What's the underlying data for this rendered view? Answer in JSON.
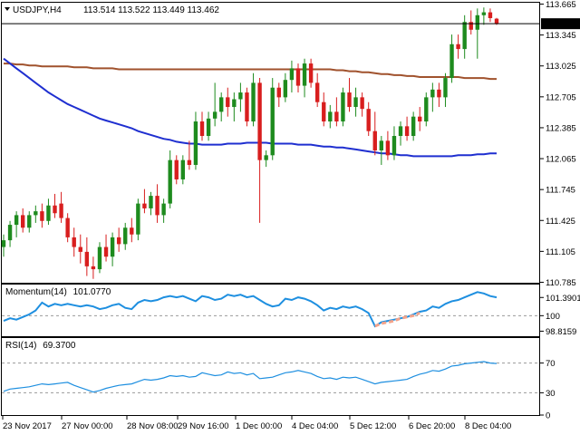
{
  "chart_data": {
    "type": "candlestick",
    "symbol_label": "USDJPY,H4",
    "ohlc_label": "113.514 113.522 113.449 113.462",
    "last_price_label": "113.462",
    "price_ylim": [
      110.78,
      113.67
    ],
    "price_ticks": [
      "113.665",
      "113.345",
      "113.025",
      "112.705",
      "112.385",
      "112.065",
      "111.745",
      "111.425",
      "111.105",
      "110.785"
    ],
    "x_labels": [
      "23 Nov 2017",
      "27 Nov 00:00",
      "28 Nov 08:00",
      "29 Nov 16:00",
      "1 Dec 00:00",
      "4 Dec 04:00",
      "5 Dec 12:00",
      "6 Dec 20:00",
      "8 Dec 04:00"
    ],
    "candles": [
      [
        111.15,
        111.28,
        111.05,
        111.22
      ],
      [
        111.22,
        111.42,
        111.15,
        111.38
      ],
      [
        111.38,
        111.52,
        111.25,
        111.48
      ],
      [
        111.48,
        111.55,
        111.3,
        111.35
      ],
      [
        111.35,
        111.52,
        111.3,
        111.48
      ],
      [
        111.48,
        111.58,
        111.4,
        111.52
      ],
      [
        111.52,
        111.6,
        111.35,
        111.42
      ],
      [
        111.42,
        111.65,
        111.38,
        111.58
      ],
      [
        111.58,
        111.7,
        111.45,
        111.5
      ],
      [
        111.6,
        111.72,
        111.4,
        111.45
      ],
      [
        111.45,
        111.5,
        111.2,
        111.25
      ],
      [
        111.25,
        111.35,
        111.05,
        111.15
      ],
      [
        111.15,
        111.28,
        110.98,
        111.1
      ],
      [
        111.1,
        111.25,
        110.85,
        110.95
      ],
      [
        110.95,
        111.05,
        110.82,
        110.92
      ],
      [
        110.92,
        111.2,
        110.88,
        111.15
      ],
      [
        111.15,
        111.28,
        111.0,
        111.05
      ],
      [
        111.05,
        111.3,
        110.95,
        111.25
      ],
      [
        111.25,
        111.35,
        111.1,
        111.18
      ],
      [
        111.18,
        111.4,
        111.12,
        111.35
      ],
      [
        111.35,
        111.45,
        111.2,
        111.28
      ],
      [
        111.28,
        111.65,
        111.22,
        111.6
      ],
      [
        111.6,
        111.75,
        111.5,
        111.55
      ],
      [
        111.55,
        111.72,
        111.48,
        111.68
      ],
      [
        111.68,
        111.8,
        111.4,
        111.48
      ],
      [
        111.48,
        111.65,
        111.4,
        111.6
      ],
      [
        111.6,
        112.15,
        111.55,
        112.05
      ],
      [
        112.05,
        112.1,
        111.8,
        111.85
      ],
      [
        111.85,
        112.1,
        111.8,
        112.05
      ],
      [
        112.05,
        112.25,
        111.95,
        112.0
      ],
      [
        112.0,
        112.55,
        111.95,
        112.45
      ],
      [
        112.45,
        112.55,
        112.25,
        112.3
      ],
      [
        112.3,
        112.55,
        112.25,
        112.48
      ],
      [
        112.48,
        112.85,
        112.4,
        112.55
      ],
      [
        112.55,
        112.75,
        112.45,
        112.7
      ],
      [
        112.7,
        112.8,
        112.5,
        112.6
      ],
      [
        112.6,
        112.75,
        112.45,
        112.68
      ],
      [
        112.68,
        112.85,
        112.55,
        112.75
      ],
      [
        112.75,
        112.8,
        112.4,
        112.45
      ],
      [
        112.45,
        112.95,
        112.4,
        112.85
      ],
      [
        112.85,
        112.9,
        111.4,
        112.05
      ],
      [
        112.05,
        112.15,
        111.98,
        112.1
      ],
      [
        112.1,
        112.9,
        112.05,
        112.8
      ],
      [
        112.8,
        112.85,
        112.6,
        112.7
      ],
      [
        112.7,
        112.95,
        112.65,
        112.88
      ],
      [
        112.88,
        113.08,
        112.75,
        113.0
      ],
      [
        113.0,
        113.05,
        112.75,
        112.82
      ],
      [
        112.82,
        113.1,
        112.7,
        113.05
      ],
      [
        113.05,
        113.1,
        112.8,
        112.85
      ],
      [
        112.85,
        112.95,
        112.6,
        112.65
      ],
      [
        112.65,
        112.75,
        112.4,
        112.45
      ],
      [
        112.45,
        112.62,
        112.38,
        112.55
      ],
      [
        112.55,
        112.7,
        112.4,
        112.45
      ],
      [
        112.45,
        112.8,
        112.4,
        112.75
      ],
      [
        112.75,
        112.9,
        112.55,
        112.6
      ],
      [
        112.6,
        112.8,
        112.5,
        112.7
      ],
      [
        112.7,
        112.75,
        112.5,
        112.58
      ],
      [
        112.58,
        112.65,
        112.3,
        112.35
      ],
      [
        112.35,
        112.55,
        112.1,
        112.15
      ],
      [
        112.15,
        112.3,
        112.0,
        112.25
      ],
      [
        112.25,
        112.35,
        112.05,
        112.1
      ],
      [
        112.1,
        112.4,
        112.05,
        112.3
      ],
      [
        112.3,
        112.45,
        112.2,
        112.4
      ],
      [
        112.4,
        112.5,
        112.25,
        112.3
      ],
      [
        112.3,
        112.55,
        112.25,
        112.5
      ],
      [
        112.5,
        112.6,
        112.35,
        112.45
      ],
      [
        112.45,
        112.75,
        112.4,
        112.7
      ],
      [
        112.7,
        112.85,
        112.55,
        112.78
      ],
      [
        112.78,
        112.85,
        112.6,
        112.7
      ],
      [
        112.7,
        112.95,
        112.6,
        112.9
      ],
      [
        112.9,
        113.35,
        112.85,
        113.25
      ],
      [
        113.25,
        113.35,
        113.1,
        113.2
      ],
      [
        113.2,
        113.55,
        113.1,
        113.48
      ],
      [
        113.48,
        113.6,
        113.35,
        113.4
      ],
      [
        113.4,
        113.62,
        113.1,
        113.55
      ],
      [
        113.55,
        113.63,
        113.45,
        113.58
      ],
      [
        113.58,
        113.62,
        113.48,
        113.52
      ],
      [
        113.514,
        113.522,
        113.449,
        113.462
      ]
    ],
    "series": [
      {
        "name": "Momentum(14)",
        "value_label": "101.0770",
        "color": "#1e8fe0",
        "ylim": [
          98.5,
          102.1
        ],
        "ticks": [
          "101.3901",
          "100",
          "98.8159"
        ],
        "values": [
          99.6,
          99.8,
          99.7,
          99.9,
          100.1,
          100.4,
          101.0,
          100.7,
          100.9,
          100.8,
          100.9,
          100.8,
          100.7,
          100.8,
          100.7,
          100.5,
          100.6,
          100.8,
          100.9,
          100.6,
          100.5,
          101.0,
          101.2,
          101.1,
          101.2,
          101.4,
          101.5,
          101.4,
          101.5,
          101.3,
          101.1,
          101.5,
          101.4,
          101.2,
          101.3,
          101.6,
          101.5,
          101.6,
          101.4,
          101.5,
          101.2,
          100.9,
          100.7,
          100.8,
          101.3,
          101.2,
          101.4,
          101.3,
          101.1,
          100.8,
          100.4,
          100.6,
          100.5,
          100.7,
          100.6,
          100.7,
          100.5,
          100.2,
          99.2,
          99.5,
          99.6,
          99.7,
          99.8,
          99.9,
          100.1,
          100.3,
          100.4,
          100.7,
          100.6,
          100.9,
          101.1,
          101.2,
          101.4,
          101.6,
          101.8,
          101.7,
          101.5,
          101.4
        ]
      },
      {
        "name": "RSI(14)",
        "value_label": "69.3700",
        "color": "#1e8fe0",
        "ylim": [
          0,
          100
        ],
        "ticks": [
          "70",
          "30",
          "0"
        ],
        "values": [
          32,
          35,
          36,
          37,
          38,
          40,
          42,
          41,
          42,
          43,
          44,
          40,
          37,
          34,
          31,
          33,
          36,
          38,
          40,
          41,
          42,
          45,
          48,
          47,
          48,
          50,
          53,
          52,
          53,
          51,
          52,
          57,
          55,
          53,
          54,
          58,
          56,
          57,
          54,
          56,
          49,
          50,
          51,
          54,
          57,
          58,
          60,
          58,
          56,
          52,
          49,
          50,
          48,
          51,
          50,
          51,
          48,
          45,
          42,
          44,
          45,
          46,
          47,
          48,
          52,
          55,
          57,
          60,
          59,
          62,
          66,
          67,
          69,
          70,
          71,
          72,
          70,
          69.37
        ]
      }
    ],
    "overlays": [
      {
        "name": "slow-ma",
        "color": "#a0522d",
        "values": [
          113.05,
          113.05,
          113.04,
          113.04,
          113.03,
          113.03,
          113.02,
          113.02,
          113.02,
          113.02,
          113.02,
          113.01,
          113.01,
          113.01,
          113.0,
          113.0,
          113.0,
          113.0,
          112.99,
          112.99,
          112.99,
          112.99,
          112.99,
          112.99,
          112.99,
          112.99,
          112.99,
          112.99,
          112.99,
          112.99,
          112.99,
          112.99,
          112.99,
          112.99,
          112.99,
          112.99,
          112.99,
          112.99,
          112.99,
          112.99,
          112.99,
          112.99,
          112.99,
          112.99,
          112.99,
          112.99,
          112.99,
          112.99,
          112.99,
          112.99,
          112.99,
          112.99,
          112.98,
          112.98,
          112.97,
          112.97,
          112.96,
          112.96,
          112.95,
          112.94,
          112.94,
          112.93,
          112.93,
          112.92,
          112.92,
          112.91,
          112.91,
          112.91,
          112.91,
          112.91,
          112.91,
          112.91,
          112.9,
          112.9,
          112.9,
          112.9,
          112.89,
          112.89
        ]
      },
      {
        "name": "fast-ma",
        "color": "#1f2fd0",
        "values": [
          113.1,
          113.05,
          113.0,
          112.95,
          112.9,
          112.85,
          112.8,
          112.75,
          112.71,
          112.67,
          112.63,
          112.6,
          112.57,
          112.54,
          112.51,
          112.48,
          112.46,
          112.44,
          112.42,
          112.4,
          112.38,
          112.35,
          112.33,
          112.31,
          112.29,
          112.27,
          112.26,
          112.24,
          112.23,
          112.22,
          112.22,
          112.21,
          112.21,
          112.21,
          112.21,
          112.22,
          112.22,
          112.22,
          112.23,
          112.23,
          112.23,
          112.23,
          112.22,
          112.22,
          112.22,
          112.22,
          112.21,
          112.21,
          112.21,
          112.2,
          112.19,
          112.19,
          112.18,
          112.18,
          112.17,
          112.16,
          112.15,
          112.14,
          112.13,
          112.12,
          112.12,
          112.11,
          112.1,
          112.1,
          112.09,
          112.09,
          112.09,
          112.09,
          112.09,
          112.09,
          112.09,
          112.1,
          112.1,
          112.1,
          112.11,
          112.11,
          112.12,
          112.12
        ]
      }
    ],
    "ma_dashed_markers": [
      [
        99.2,
        99.4,
        99.5,
        99.6,
        99.8,
        99.9,
        100.0,
        100.2
      ]
    ],
    "ref_levels": {
      "momentum": 100,
      "rsi": [
        70,
        30
      ]
    }
  }
}
